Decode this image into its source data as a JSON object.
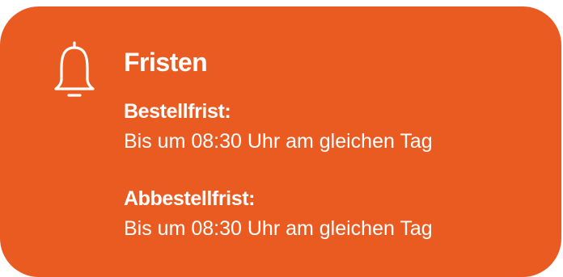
{
  "card": {
    "icon": "bell-icon",
    "title": "Fristen",
    "accent_color": "#ea5b21",
    "items": [
      {
        "label": "Bestellfrist:",
        "value": "Bis um 08:30 Uhr am gleichen Tag"
      },
      {
        "label": "Abbestellfrist:",
        "value": "Bis um 08:30 Uhr am gleichen Tag"
      }
    ]
  }
}
